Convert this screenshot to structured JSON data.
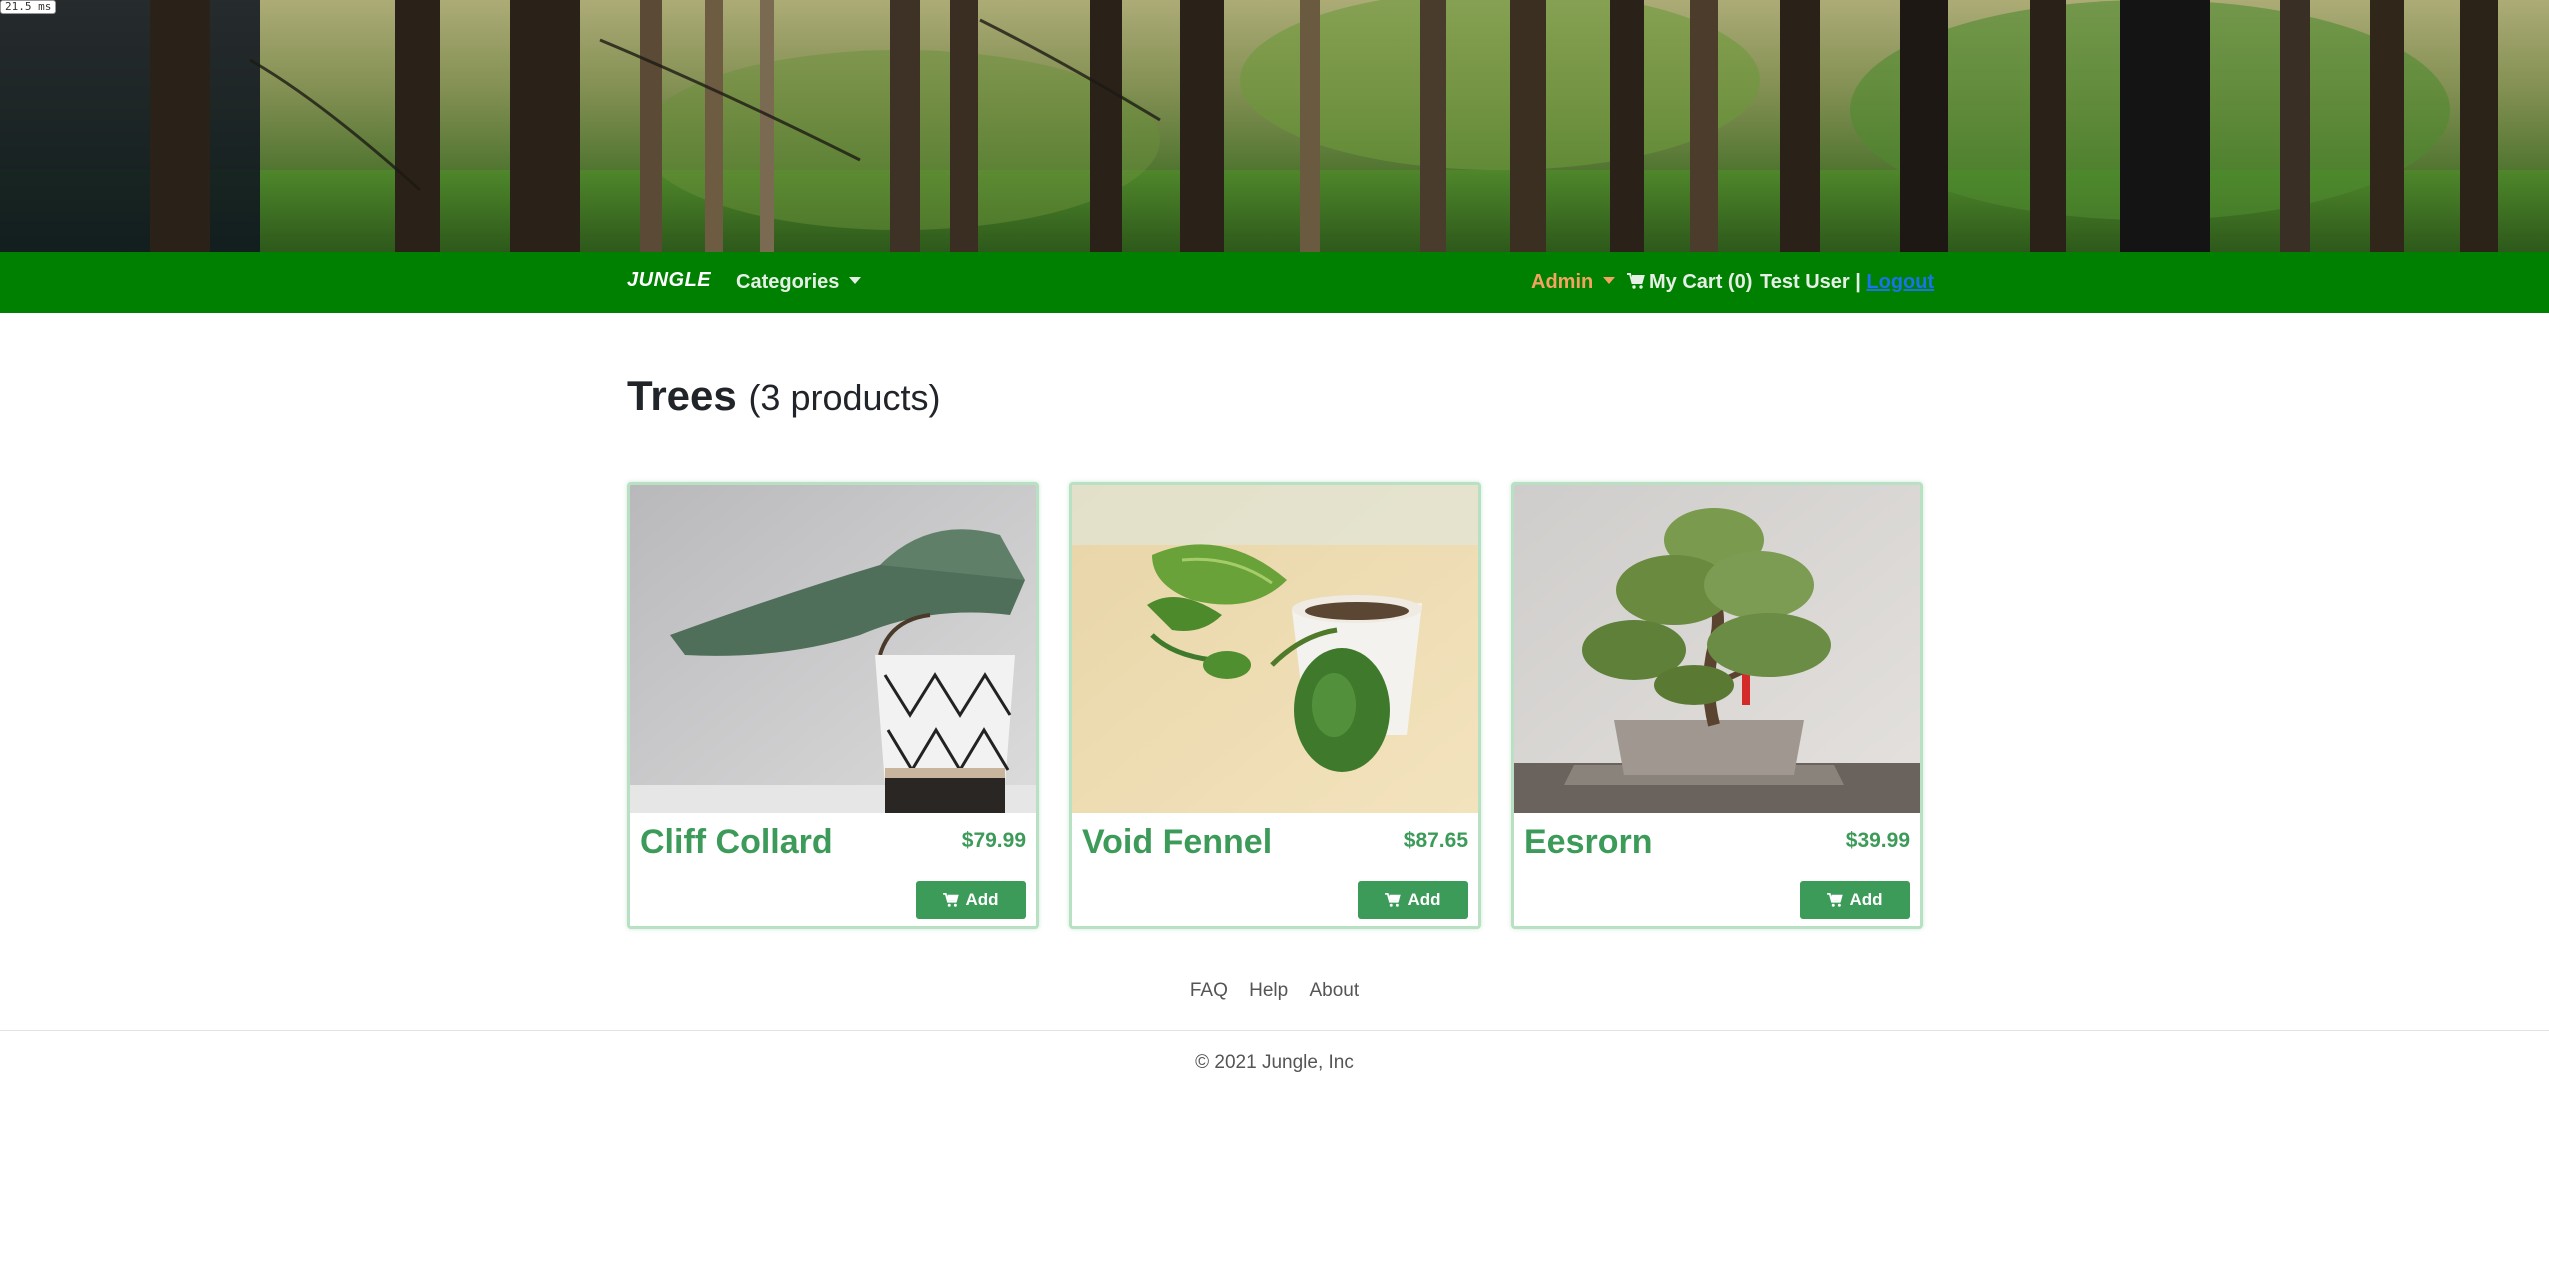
{
  "timing_badge": "21.5 ms",
  "navbar": {
    "brand": "JUNGLE",
    "categories_label": "Categories",
    "admin_label": "Admin",
    "cart_label": "My Cart (0)",
    "user_label": "Test User |",
    "logout_label": "Logout",
    "bg_color": "#008000"
  },
  "page": {
    "title": "Trees",
    "count": "(3 products)"
  },
  "products": [
    {
      "name": "Cliff Collard",
      "price": "$79.99",
      "add_label": "Add"
    },
    {
      "name": "Void Fennel",
      "price": "$87.65",
      "add_label": "Add"
    },
    {
      "name": "Eesrorn",
      "price": "$39.99",
      "add_label": "Add"
    }
  ],
  "footer": {
    "links": [
      "FAQ",
      "Help",
      "About"
    ],
    "copyright": "© 2021 Jungle, Inc"
  },
  "colors": {
    "accent": "#3d9b5a",
    "admin": "#f4a460",
    "logout": "#1a73e8"
  },
  "icons": [
    "cart-icon",
    "caret-down-icon"
  ]
}
